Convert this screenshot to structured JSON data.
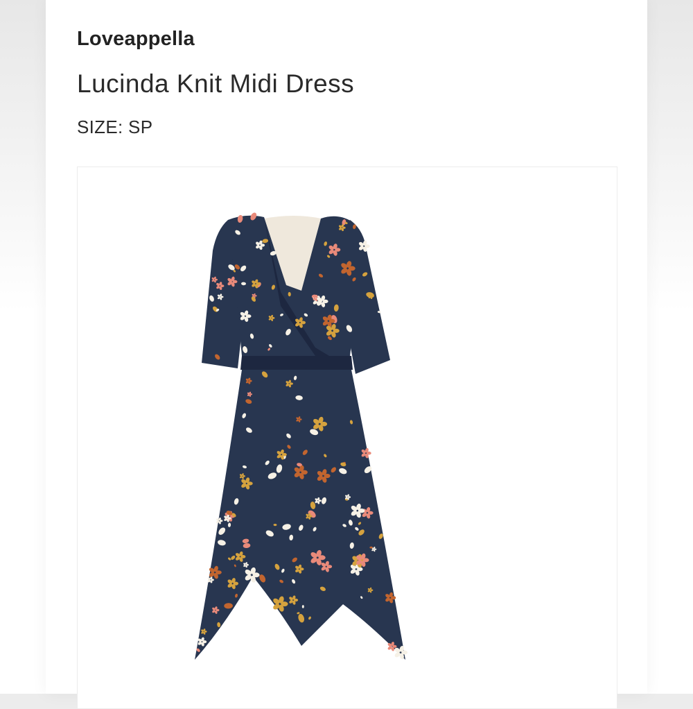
{
  "product": {
    "brand": "Loveappella",
    "name": "Lucinda Knit Midi Dress",
    "size_label": "SIZE:",
    "size_value": "SP"
  },
  "image": {
    "subject": "navy floral wrap midi dress",
    "colors": {
      "fabric": "#283650",
      "fabric_shadow": "#1d2740",
      "flower_white": "#f6f1e6",
      "flower_pink": "#e98a7a",
      "flower_gold": "#d5a23e",
      "flower_rust": "#c2652f"
    }
  }
}
